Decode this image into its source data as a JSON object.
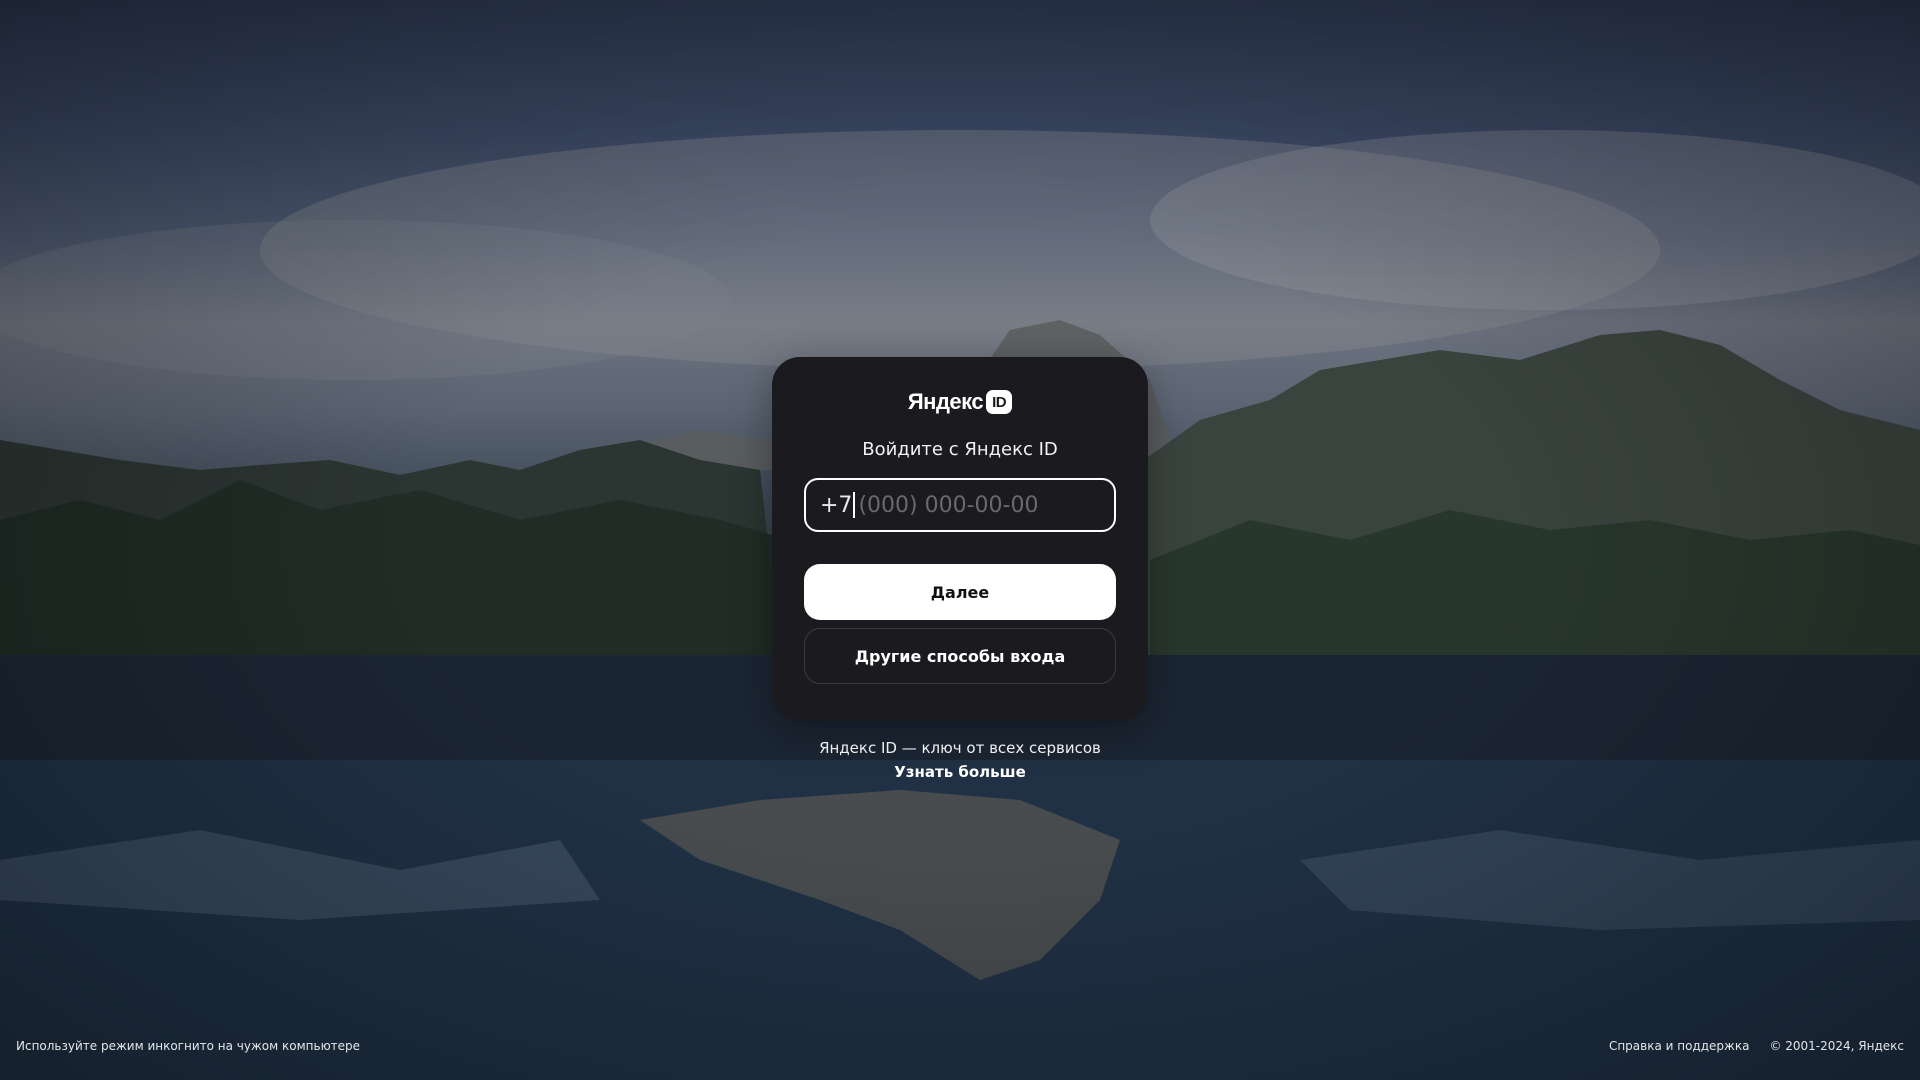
{
  "logo": {
    "word": "Яндекс",
    "badge": "ID"
  },
  "login": {
    "heading": "Войдите с Яндекс ID",
    "phone_prefix": "+7",
    "phone_placeholder": "(000) 000-00-00",
    "next_button": "Далее",
    "other_methods_button": "Другие способы входа"
  },
  "promo": {
    "text": "Яндекс ID — ключ от всех сервисов",
    "link": "Узнать больше"
  },
  "footer": {
    "incognito_hint": "Используйте режим инкогнито на чужом компьютере",
    "help_link": "Справка и поддержка",
    "copyright": "© 2001-2024, Яндекс"
  },
  "colors": {
    "card_background": "#1b1a1e",
    "primary_button": "#ffffff",
    "placeholder": "#6a6970"
  }
}
